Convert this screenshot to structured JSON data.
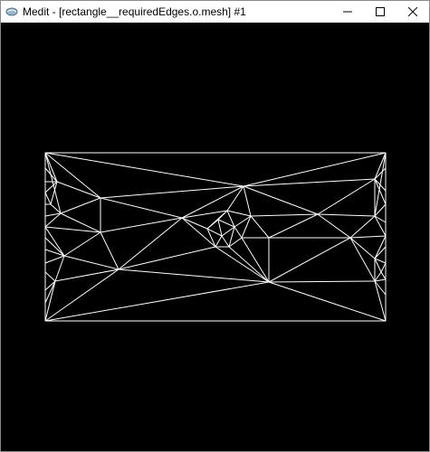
{
  "window": {
    "title": "Medit - [rectangle__requiredEdges.o.mesh] #1",
    "icon": "medit-logo-icon",
    "controls": {
      "minimize_icon": "minimize-icon",
      "maximize_icon": "maximize-icon",
      "close_icon": "close-icon"
    }
  },
  "viewport": {
    "background_color": "#000000",
    "mesh_color": "#ffffff",
    "content": "triangulated rectangle mesh wireframe"
  }
}
